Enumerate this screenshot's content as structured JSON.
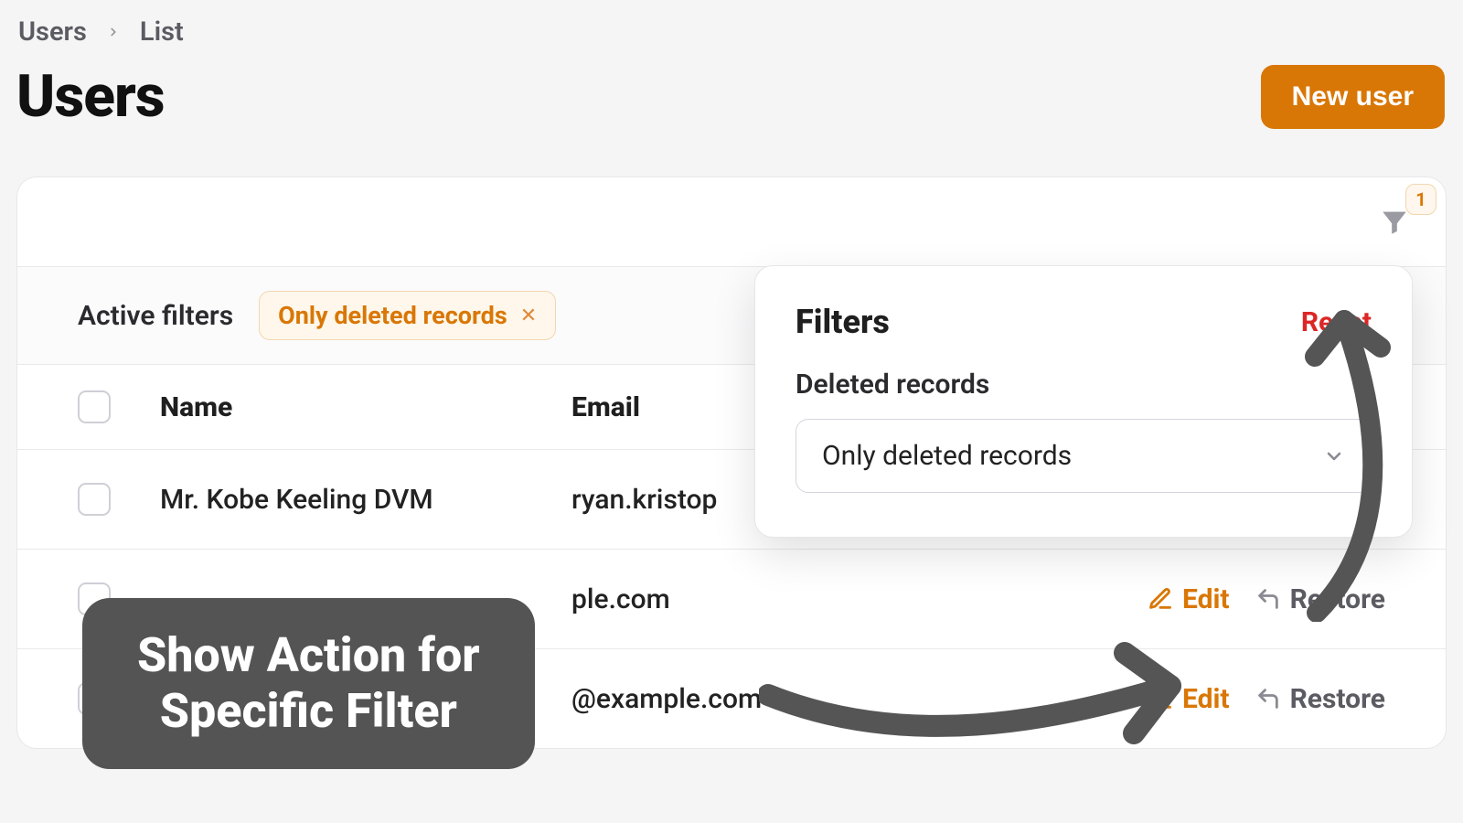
{
  "breadcrumb": {
    "root": "Users",
    "current": "List"
  },
  "header": {
    "title": "Users",
    "new_button": "New user"
  },
  "toolbar": {
    "filter_badge": "1"
  },
  "filters_bar": {
    "label": "Active filters",
    "chip": {
      "label": "Only deleted records"
    }
  },
  "popover": {
    "title": "Filters",
    "reset": "Reset",
    "deleted_label": "Deleted records",
    "deleted_select_value": "Only deleted records"
  },
  "table": {
    "columns": {
      "name": "Name",
      "email": "Email"
    },
    "actions": {
      "edit": "Edit",
      "restore": "Restore"
    },
    "rows": [
      {
        "name": "Mr. Kobe Keeling DVM",
        "email": "ryan.kristop"
      },
      {
        "name": "",
        "email": "ple.com"
      },
      {
        "name": "",
        "email": "@example.com"
      }
    ]
  },
  "annotation": {
    "line1": "Show Action for",
    "line2": "Specific Filter"
  }
}
